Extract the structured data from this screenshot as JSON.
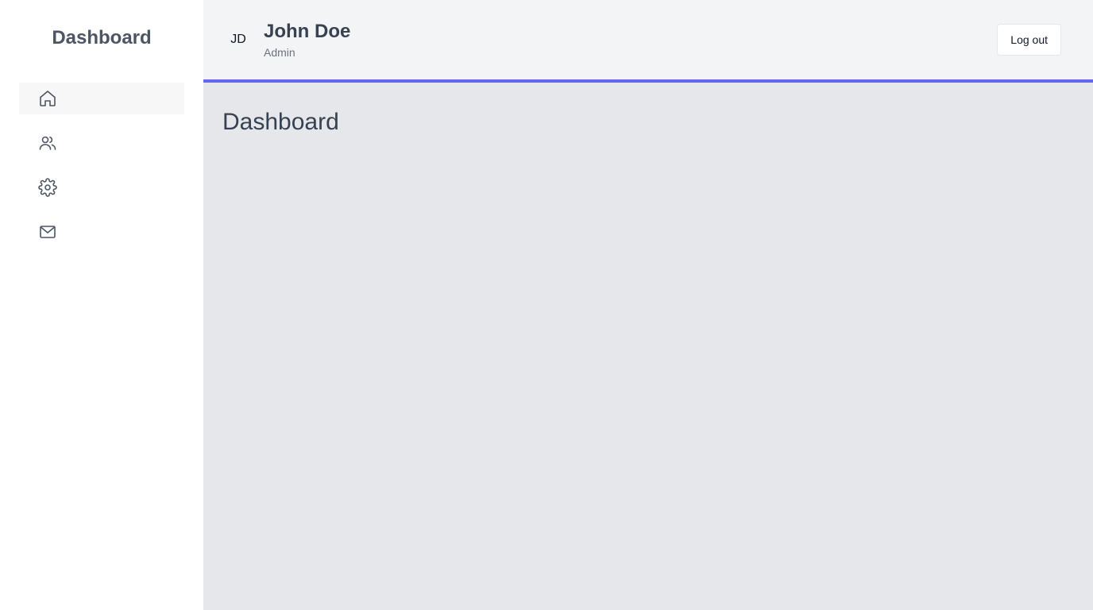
{
  "sidebar": {
    "title": "Dashboard",
    "items": [
      {
        "icon": "home-icon",
        "active": true
      },
      {
        "icon": "users-icon",
        "active": false
      },
      {
        "icon": "gear-icon",
        "active": false
      },
      {
        "icon": "mail-icon",
        "active": false
      }
    ]
  },
  "header": {
    "avatar_initials": "JD",
    "user_name": "John Doe",
    "user_role": "Admin",
    "logout_label": "Log out"
  },
  "main": {
    "page_title": "Dashboard"
  },
  "colors": {
    "accent": "#6366f1",
    "sidebar_bg": "#ffffff",
    "header_bg": "#f3f4f6",
    "content_bg": "#e5e7eb",
    "text": "#374151"
  }
}
